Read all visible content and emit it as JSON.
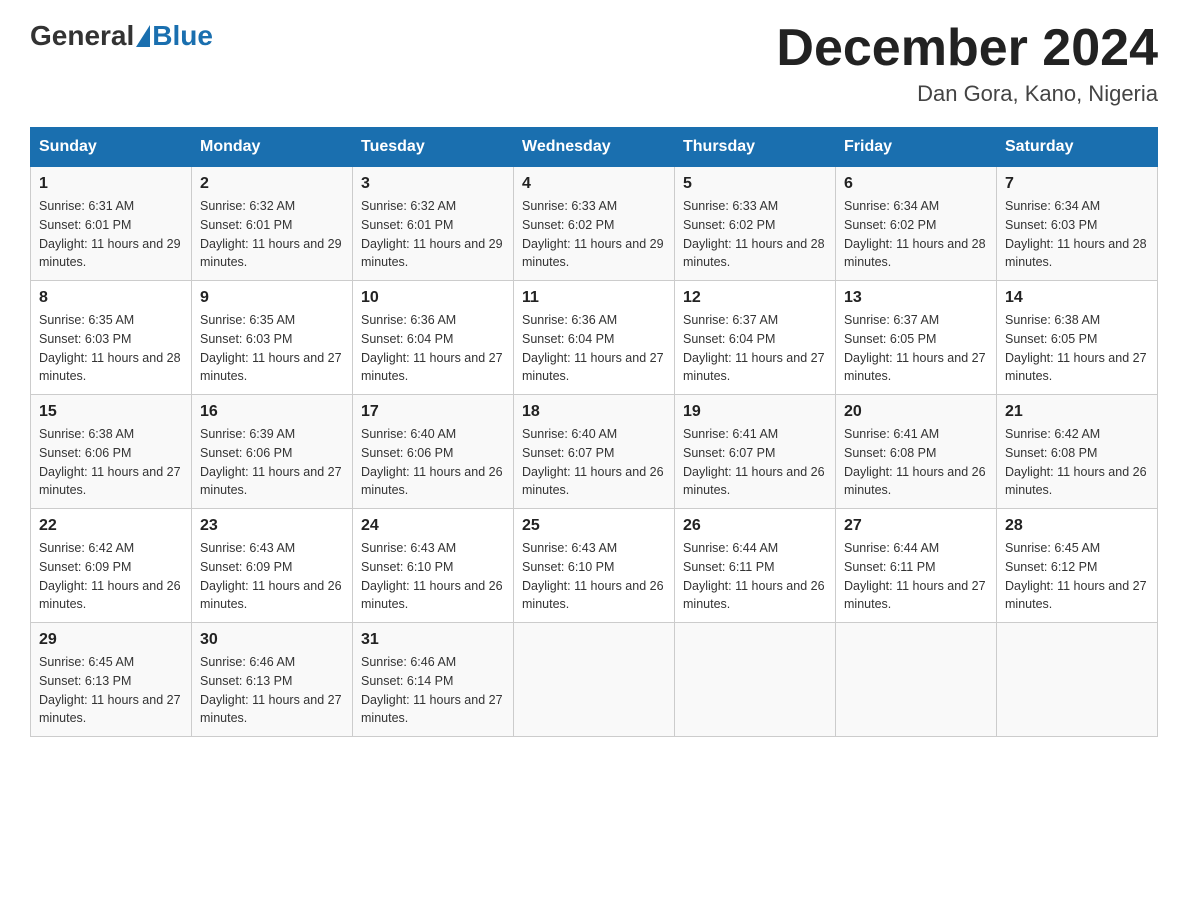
{
  "header": {
    "logo_general": "General",
    "logo_blue": "Blue",
    "month_title": "December 2024",
    "location": "Dan Gora, Kano, Nigeria"
  },
  "days_of_week": [
    "Sunday",
    "Monday",
    "Tuesday",
    "Wednesday",
    "Thursday",
    "Friday",
    "Saturday"
  ],
  "weeks": [
    [
      {
        "day": "1",
        "sunrise": "Sunrise: 6:31 AM",
        "sunset": "Sunset: 6:01 PM",
        "daylight": "Daylight: 11 hours and 29 minutes."
      },
      {
        "day": "2",
        "sunrise": "Sunrise: 6:32 AM",
        "sunset": "Sunset: 6:01 PM",
        "daylight": "Daylight: 11 hours and 29 minutes."
      },
      {
        "day": "3",
        "sunrise": "Sunrise: 6:32 AM",
        "sunset": "Sunset: 6:01 PM",
        "daylight": "Daylight: 11 hours and 29 minutes."
      },
      {
        "day": "4",
        "sunrise": "Sunrise: 6:33 AM",
        "sunset": "Sunset: 6:02 PM",
        "daylight": "Daylight: 11 hours and 29 minutes."
      },
      {
        "day": "5",
        "sunrise": "Sunrise: 6:33 AM",
        "sunset": "Sunset: 6:02 PM",
        "daylight": "Daylight: 11 hours and 28 minutes."
      },
      {
        "day": "6",
        "sunrise": "Sunrise: 6:34 AM",
        "sunset": "Sunset: 6:02 PM",
        "daylight": "Daylight: 11 hours and 28 minutes."
      },
      {
        "day": "7",
        "sunrise": "Sunrise: 6:34 AM",
        "sunset": "Sunset: 6:03 PM",
        "daylight": "Daylight: 11 hours and 28 minutes."
      }
    ],
    [
      {
        "day": "8",
        "sunrise": "Sunrise: 6:35 AM",
        "sunset": "Sunset: 6:03 PM",
        "daylight": "Daylight: 11 hours and 28 minutes."
      },
      {
        "day": "9",
        "sunrise": "Sunrise: 6:35 AM",
        "sunset": "Sunset: 6:03 PM",
        "daylight": "Daylight: 11 hours and 27 minutes."
      },
      {
        "day": "10",
        "sunrise": "Sunrise: 6:36 AM",
        "sunset": "Sunset: 6:04 PM",
        "daylight": "Daylight: 11 hours and 27 minutes."
      },
      {
        "day": "11",
        "sunrise": "Sunrise: 6:36 AM",
        "sunset": "Sunset: 6:04 PM",
        "daylight": "Daylight: 11 hours and 27 minutes."
      },
      {
        "day": "12",
        "sunrise": "Sunrise: 6:37 AM",
        "sunset": "Sunset: 6:04 PM",
        "daylight": "Daylight: 11 hours and 27 minutes."
      },
      {
        "day": "13",
        "sunrise": "Sunrise: 6:37 AM",
        "sunset": "Sunset: 6:05 PM",
        "daylight": "Daylight: 11 hours and 27 minutes."
      },
      {
        "day": "14",
        "sunrise": "Sunrise: 6:38 AM",
        "sunset": "Sunset: 6:05 PM",
        "daylight": "Daylight: 11 hours and 27 minutes."
      }
    ],
    [
      {
        "day": "15",
        "sunrise": "Sunrise: 6:38 AM",
        "sunset": "Sunset: 6:06 PM",
        "daylight": "Daylight: 11 hours and 27 minutes."
      },
      {
        "day": "16",
        "sunrise": "Sunrise: 6:39 AM",
        "sunset": "Sunset: 6:06 PM",
        "daylight": "Daylight: 11 hours and 27 minutes."
      },
      {
        "day": "17",
        "sunrise": "Sunrise: 6:40 AM",
        "sunset": "Sunset: 6:06 PM",
        "daylight": "Daylight: 11 hours and 26 minutes."
      },
      {
        "day": "18",
        "sunrise": "Sunrise: 6:40 AM",
        "sunset": "Sunset: 6:07 PM",
        "daylight": "Daylight: 11 hours and 26 minutes."
      },
      {
        "day": "19",
        "sunrise": "Sunrise: 6:41 AM",
        "sunset": "Sunset: 6:07 PM",
        "daylight": "Daylight: 11 hours and 26 minutes."
      },
      {
        "day": "20",
        "sunrise": "Sunrise: 6:41 AM",
        "sunset": "Sunset: 6:08 PM",
        "daylight": "Daylight: 11 hours and 26 minutes."
      },
      {
        "day": "21",
        "sunrise": "Sunrise: 6:42 AM",
        "sunset": "Sunset: 6:08 PM",
        "daylight": "Daylight: 11 hours and 26 minutes."
      }
    ],
    [
      {
        "day": "22",
        "sunrise": "Sunrise: 6:42 AM",
        "sunset": "Sunset: 6:09 PM",
        "daylight": "Daylight: 11 hours and 26 minutes."
      },
      {
        "day": "23",
        "sunrise": "Sunrise: 6:43 AM",
        "sunset": "Sunset: 6:09 PM",
        "daylight": "Daylight: 11 hours and 26 minutes."
      },
      {
        "day": "24",
        "sunrise": "Sunrise: 6:43 AM",
        "sunset": "Sunset: 6:10 PM",
        "daylight": "Daylight: 11 hours and 26 minutes."
      },
      {
        "day": "25",
        "sunrise": "Sunrise: 6:43 AM",
        "sunset": "Sunset: 6:10 PM",
        "daylight": "Daylight: 11 hours and 26 minutes."
      },
      {
        "day": "26",
        "sunrise": "Sunrise: 6:44 AM",
        "sunset": "Sunset: 6:11 PM",
        "daylight": "Daylight: 11 hours and 26 minutes."
      },
      {
        "day": "27",
        "sunrise": "Sunrise: 6:44 AM",
        "sunset": "Sunset: 6:11 PM",
        "daylight": "Daylight: 11 hours and 27 minutes."
      },
      {
        "day": "28",
        "sunrise": "Sunrise: 6:45 AM",
        "sunset": "Sunset: 6:12 PM",
        "daylight": "Daylight: 11 hours and 27 minutes."
      }
    ],
    [
      {
        "day": "29",
        "sunrise": "Sunrise: 6:45 AM",
        "sunset": "Sunset: 6:13 PM",
        "daylight": "Daylight: 11 hours and 27 minutes."
      },
      {
        "day": "30",
        "sunrise": "Sunrise: 6:46 AM",
        "sunset": "Sunset: 6:13 PM",
        "daylight": "Daylight: 11 hours and 27 minutes."
      },
      {
        "day": "31",
        "sunrise": "Sunrise: 6:46 AM",
        "sunset": "Sunset: 6:14 PM",
        "daylight": "Daylight: 11 hours and 27 minutes."
      },
      null,
      null,
      null,
      null
    ]
  ]
}
